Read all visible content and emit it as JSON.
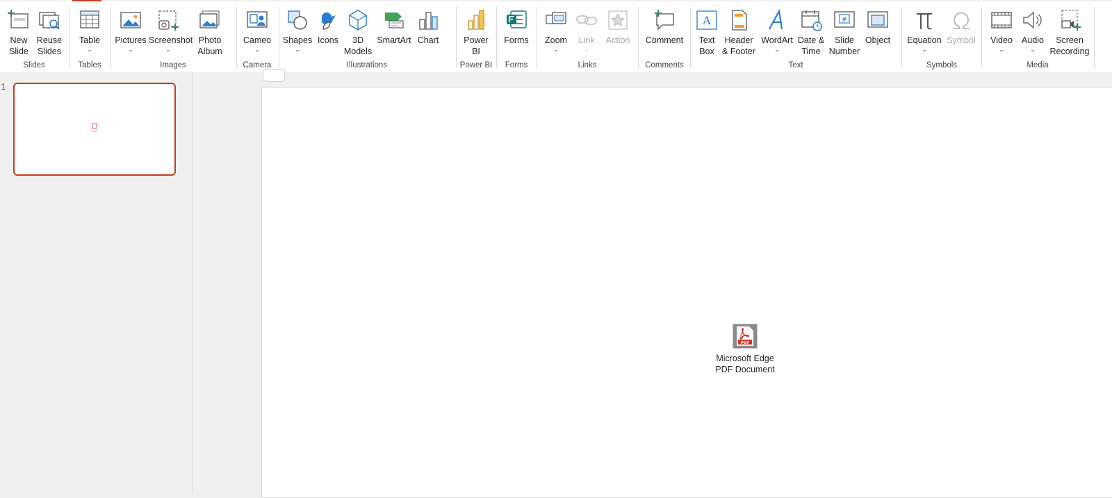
{
  "ribbon": {
    "groups": [
      {
        "label": "Slides"
      },
      {
        "label": "Tables"
      },
      {
        "label": "Images"
      },
      {
        "label": "Camera"
      },
      {
        "label": "Illustrations"
      },
      {
        "label": "Power BI"
      },
      {
        "label": "Forms"
      },
      {
        "label": "Links"
      },
      {
        "label": "Comments"
      },
      {
        "label": "Text"
      },
      {
        "label": "Symbols"
      },
      {
        "label": "Media"
      }
    ],
    "buttons": {
      "new_slide": "New\nSlide",
      "reuse_slides": "Reuse\nSlides",
      "table": "Table",
      "pictures": "Pictures",
      "screenshot": "Screenshot",
      "photo_album": "Photo\nAlbum",
      "cameo": "Cameo",
      "shapes": "Shapes",
      "icons": "Icons",
      "models_3d": "3D\nModels",
      "smartart": "SmartArt",
      "chart": "Chart",
      "power_bi": "Power\nBI",
      "forms": "Forms",
      "zoom": "Zoom",
      "link": "Link",
      "action": "Action",
      "comment": "Comment",
      "text_box": "Text\nBox",
      "header_footer": "Header\n& Footer",
      "wordart": "WordArt",
      "date_time": "Date &\nTime",
      "slide_number": "Slide\nNumber",
      "object": "Object",
      "equation": "Equation",
      "symbol": "Symbol",
      "video": "Video",
      "audio": "Audio",
      "screen_recording": "Screen\nRecording"
    },
    "caret": "⌄"
  },
  "thumbnails": {
    "slide_number": "1"
  },
  "slide": {
    "embedded_object_caption": "Microsoft Edge\nPDF Document",
    "embedded_object_icon": "pdf-icon"
  },
  "colors": {
    "accent": "#c43e1c",
    "ribbon_bg": "#ffffff",
    "workspace_bg": "#f0f0f0",
    "icon_blue": "#2b7cd3"
  }
}
